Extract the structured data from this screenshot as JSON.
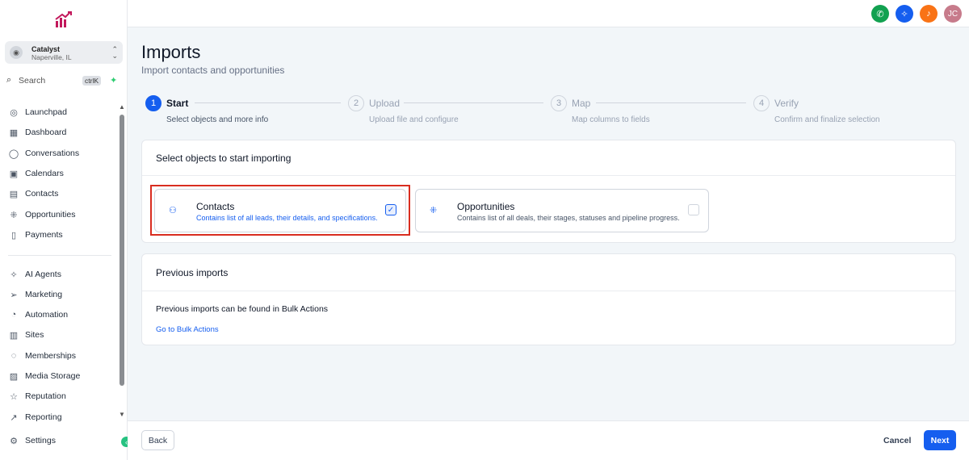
{
  "sidebar": {
    "location": {
      "name": "Catalyst",
      "city": "Naperville, IL"
    },
    "search": {
      "label": "Search",
      "shortcut": "ctrlK"
    },
    "items": [
      {
        "label": "Launchpad",
        "icon": "launchpad-icon",
        "glyph": "◎"
      },
      {
        "label": "Dashboard",
        "icon": "dashboard-icon",
        "glyph": "▦"
      },
      {
        "label": "Conversations",
        "icon": "chat-icon",
        "glyph": "◯"
      },
      {
        "label": "Calendars",
        "icon": "calendar-icon",
        "glyph": "▣"
      },
      {
        "label": "Contacts",
        "icon": "contacts-icon",
        "glyph": "▤"
      },
      {
        "label": "Opportunities",
        "icon": "opportunities-icon",
        "glyph": "⁜"
      },
      {
        "label": "Payments",
        "icon": "payments-icon",
        "glyph": "▯"
      },
      {
        "label": "AI Agents",
        "icon": "ai-agents-icon",
        "glyph": "✧"
      },
      {
        "label": "Marketing",
        "icon": "marketing-icon",
        "glyph": "➢"
      },
      {
        "label": "Automation",
        "icon": "automation-icon",
        "glyph": "◔"
      },
      {
        "label": "Sites",
        "icon": "sites-icon",
        "glyph": "▥"
      },
      {
        "label": "Memberships",
        "icon": "memberships-icon",
        "glyph": "◌"
      },
      {
        "label": "Media Storage",
        "icon": "media-icon",
        "glyph": "▨"
      },
      {
        "label": "Reputation",
        "icon": "star-icon",
        "glyph": "☆"
      },
      {
        "label": "Reporting",
        "icon": "reporting-icon",
        "glyph": "↗"
      }
    ],
    "settings": {
      "label": "Settings",
      "icon": "gear-icon",
      "glyph": "⚙"
    }
  },
  "topbar": {
    "avatar_initials": "JC",
    "colors": {
      "phone": "#12a150",
      "sparkle": "#155eef",
      "bell": "#f97316",
      "avatar": "#c77b8b"
    }
  },
  "page": {
    "title": "Imports",
    "subtitle": "Import contacts and opportunities"
  },
  "steps": [
    {
      "num": "1",
      "label": "Start",
      "desc": "Select objects and more info",
      "active": true
    },
    {
      "num": "2",
      "label": "Upload",
      "desc": "Upload file and configure",
      "active": false
    },
    {
      "num": "3",
      "label": "Map",
      "desc": "Map columns to fields",
      "active": false
    },
    {
      "num": "4",
      "label": "Verify",
      "desc": "Confirm and finalize selection",
      "active": false
    }
  ],
  "select_card": {
    "heading": "Select objects to start importing",
    "options": [
      {
        "title": "Contacts",
        "desc": "Contains list of all leads, their details, and specifications.",
        "selected": true
      },
      {
        "title": "Opportunities",
        "desc": "Contains list of all deals, their stages, statuses and pipeline progress.",
        "selected": false
      }
    ]
  },
  "previous_card": {
    "heading": "Previous imports",
    "text": "Previous imports can be found in Bulk Actions",
    "link": "Go to Bulk Actions"
  },
  "footer": {
    "back": "Back",
    "cancel": "Cancel",
    "next": "Next"
  }
}
